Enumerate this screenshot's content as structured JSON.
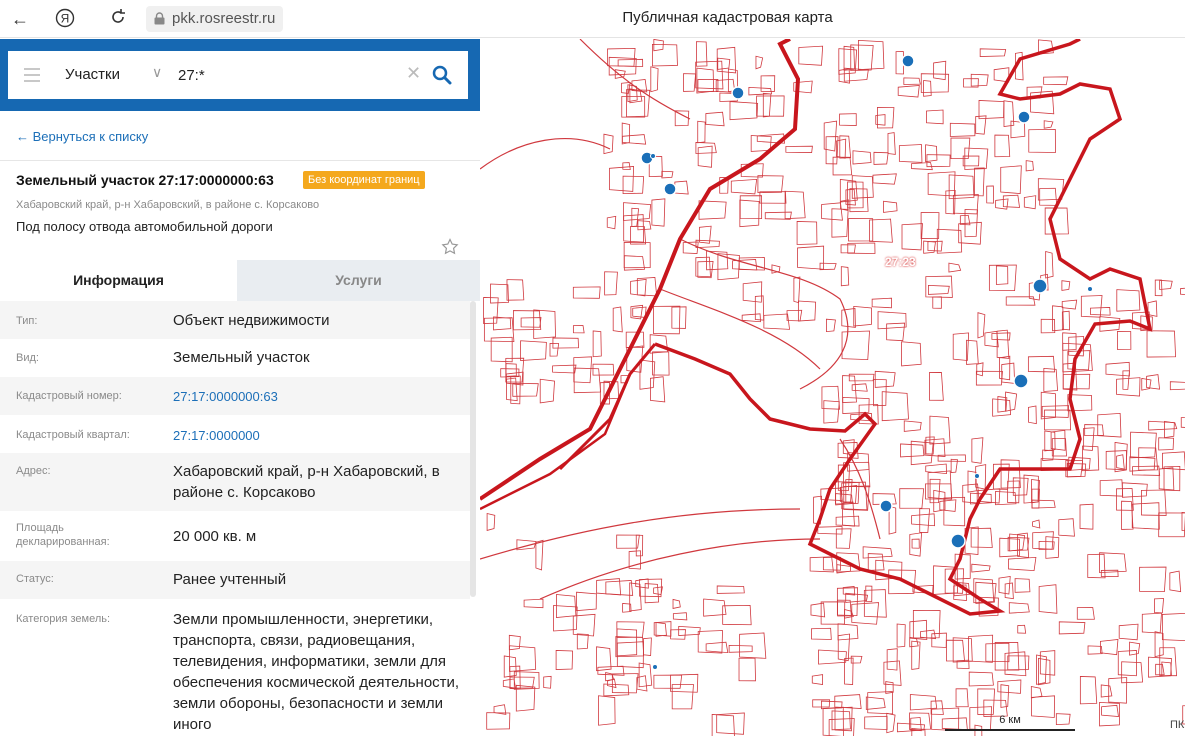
{
  "browser": {
    "url": "pkk.rosreestr.ru",
    "page_title": "Публичная кадастровая карта"
  },
  "search": {
    "type_label": "Участки",
    "query": "27:*"
  },
  "panel": {
    "back_link": "← Вернуться к списку",
    "object_title": "Земельный участок 27:17:0000000:63",
    "badge": "Без координат границ",
    "badge_color": "#f4a81d",
    "address_short": "Хабаровский край, р-н Хабаровский, в районе с. Корсаково",
    "purpose": "Под полосу отвода автомобильной дороги",
    "tabs": [
      "Информация",
      "Услуги"
    ],
    "active_tab": "Информация",
    "rows": [
      {
        "label": "Тип:",
        "value": "Объект недвижимости"
      },
      {
        "label": "Вид:",
        "value": "Земельный участок"
      },
      {
        "label": "Кадастровый номер:",
        "value": "27:17:0000000:63"
      },
      {
        "label": "Кадастровый квартал:",
        "value": "27:17:0000000"
      },
      {
        "label": "Адрес:",
        "value": "Хабаровский край, р-н Хабаровский, в районе с. Корсаково"
      },
      {
        "label": "Площадь декларированная:",
        "value": "20 000 кв. м"
      },
      {
        "label": "Статус:",
        "value": "Ранее учтенный"
      },
      {
        "label": "Категория земель:",
        "value": "Земли промышленности, энергетики, транспорта, связи, радиовещания, телевидения, информатики, земли для обеспечения космической деятельности, земли обороны, безопасности и земли иного"
      }
    ]
  },
  "map": {
    "quarter_label": "27:23",
    "scale_label": "6 км",
    "corner_text": "ПК",
    "border_color": "#c8161d",
    "marker_color": "#1a6fb8"
  }
}
